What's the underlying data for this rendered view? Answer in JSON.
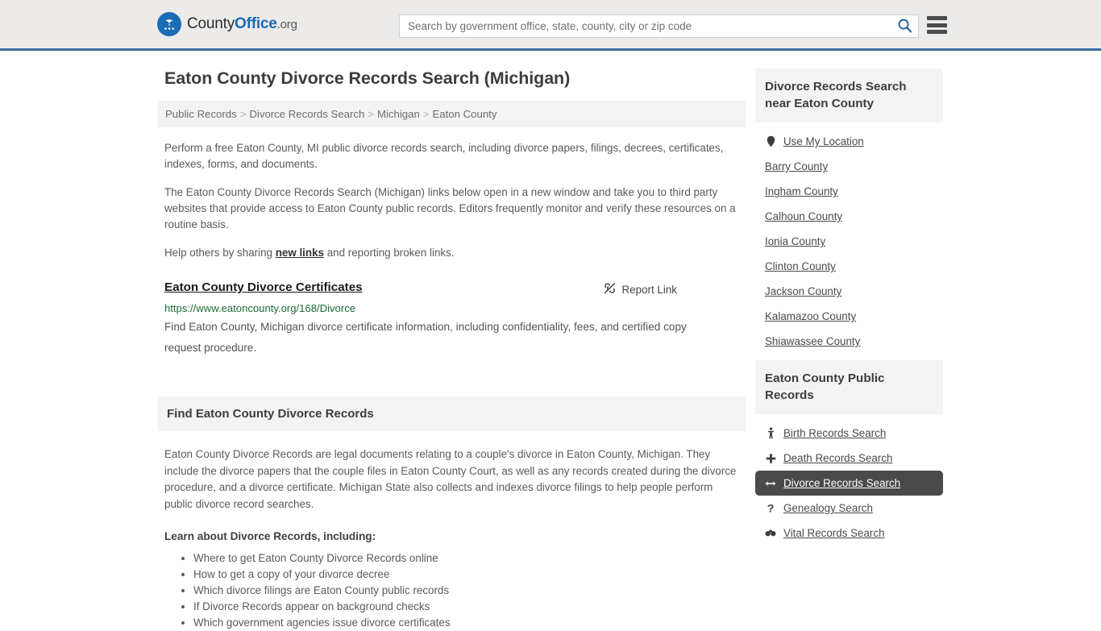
{
  "header": {
    "brand": {
      "part1": "County",
      "part2": "Office",
      "tld": ".org"
    },
    "search": {
      "placeholder": "Search by government office, state, county, city or zip code",
      "value": ""
    },
    "search_icon": "search-icon",
    "menu_icon": "hamburger-menu-icon",
    "accent_color": "#1a6bb5",
    "border_color": "#3a6ea5",
    "background": "#ecebe9"
  },
  "main": {
    "title": "Eaton County Divorce Records Search (Michigan)",
    "breadcrumb": [
      "Public Records",
      "Divorce Records Search",
      "Michigan",
      "Eaton County"
    ],
    "breadcrumb_separator": ">",
    "paragraphs": {
      "p1": "Perform a free Eaton County, MI public divorce records search, including divorce papers, filings, decrees, certificates, indexes, forms, and documents.",
      "p2": "The Eaton County Divorce Records Search (Michigan) links below open in a new window and take you to third party websites that provide access to Eaton County public records. Editors frequently monitor and verify these resources on a routine basis.",
      "p3_before": "Help others by sharing ",
      "p3_link": "new links",
      "p3_after": " and reporting broken links."
    },
    "result": {
      "title": "Eaton County Divorce Certificates",
      "url": "https://www.eatoncounty.org/168/Divorce",
      "description": "Find Eaton County, Michigan divorce certificate information, including confidentiality, fees, and certified copy request procedure.",
      "report_label": "Report Link",
      "report_icon": "broken-link-icon",
      "url_color": "#1c6b36"
    },
    "section": {
      "heading": "Find Eaton County Divorce Records",
      "paragraph": "Eaton County Divorce Records are legal documents relating to a couple's divorce in Eaton County, Michigan. They include the divorce papers that the couple files in Eaton County Court, as well as any records created during the divorce procedure, and a divorce certificate. Michigan State also collects and indexes divorce filings to help people perform public divorce record searches.",
      "learn_heading": "Learn about Divorce Records, including:",
      "learn_items": [
        "Where to get Eaton County Divorce Records online",
        "How to get a copy of your divorce decree",
        "Which divorce filings are Eaton County public records",
        "If Divorce Records appear on background checks",
        "Which government agencies issue divorce certificates"
      ]
    }
  },
  "sidebar": {
    "nearby": {
      "heading": "Divorce Records Search near Eaton County",
      "items": [
        {
          "label": "Use My Location",
          "icon": "map-pin-icon",
          "has_icon": true
        },
        {
          "label": "Barry County",
          "icon": "",
          "has_icon": false
        },
        {
          "label": "Ingham County",
          "icon": "",
          "has_icon": false
        },
        {
          "label": "Calhoun County",
          "icon": "",
          "has_icon": false
        },
        {
          "label": "Ionia County",
          "icon": "",
          "has_icon": false
        },
        {
          "label": "Clinton County",
          "icon": "",
          "has_icon": false
        },
        {
          "label": "Jackson County",
          "icon": "",
          "has_icon": false
        },
        {
          "label": "Kalamazoo County",
          "icon": "",
          "has_icon": false
        },
        {
          "label": "Shiawassee County",
          "icon": "",
          "has_icon": false
        }
      ]
    },
    "public_records": {
      "heading": "Eaton County Public Records",
      "active_index": 2,
      "active_background": "#4a4a4a",
      "items": [
        {
          "label": "Birth Records Search",
          "icon": "baby-icon",
          "glyph": "Ɣ"
        },
        {
          "label": "Death Records Search",
          "icon": "cross-icon",
          "glyph": "✚"
        },
        {
          "label": "Divorce Records Search",
          "icon": "left-right-arrow-icon",
          "glyph": "↔"
        },
        {
          "label": "Genealogy Search",
          "icon": "question-mark-icon",
          "glyph": "?"
        },
        {
          "label": "Vital Records Search",
          "icon": "binoculars-icon",
          "glyph": "●●"
        }
      ]
    }
  }
}
